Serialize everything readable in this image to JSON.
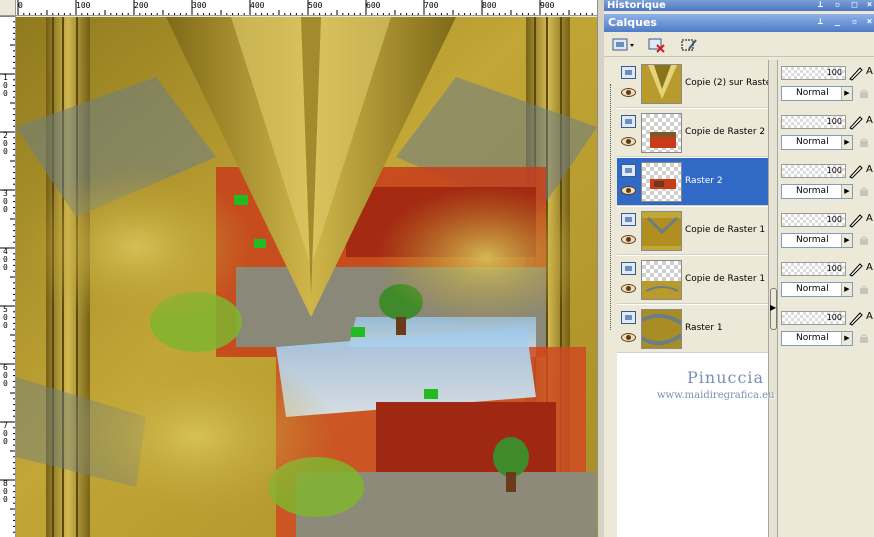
{
  "rulers": {
    "top_labels": [
      "0",
      "100",
      "200",
      "300",
      "400",
      "500",
      "600",
      "700",
      "800",
      "900"
    ],
    "left_labels": [
      "100",
      "200",
      "300",
      "400",
      "500",
      "600",
      "700",
      "800"
    ]
  },
  "panels": {
    "history_title": "Historique",
    "layers_title": "Calques"
  },
  "layers": [
    {
      "name": "Copie (2) sur Raster",
      "opacity": "100",
      "blend": "Normal",
      "selected": false
    },
    {
      "name": "Copie de Raster 2",
      "opacity": "100",
      "blend": "Normal",
      "selected": false
    },
    {
      "name": "Raster 2",
      "opacity": "100",
      "blend": "Normal",
      "selected": true
    },
    {
      "name": "Copie de Raster 1",
      "opacity": "100",
      "blend": "Normal",
      "selected": false
    },
    {
      "name": "Copie de Raster 1",
      "opacity": "100",
      "blend": "Normal",
      "selected": false
    },
    {
      "name": "Raster 1",
      "opacity": "100",
      "blend": "Normal",
      "selected": false
    }
  ],
  "watermark": {
    "name": "Pinuccia",
    "url": "www.maidiregrafica.eu"
  },
  "colors": {
    "selection": "#3169c6",
    "title_bar": "#4f7bc7",
    "canvas_gold": "#b99a2c"
  }
}
